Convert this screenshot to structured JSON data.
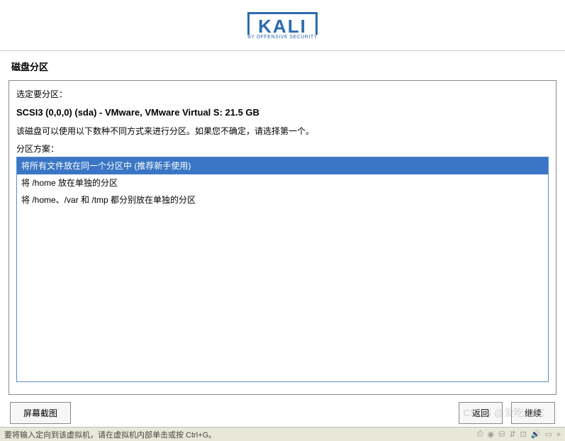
{
  "logo": {
    "text": "KALI",
    "tagline": "BY OFFENSIVE SECURITY"
  },
  "page_title": "磁盘分区",
  "content": {
    "prompt": "选定要分区：",
    "disk": "SCSI3 (0,0,0) (sda) - VMware, VMware Virtual S: 21.5 GB",
    "instruction": "该磁盘可以使用以下数种不同方式来进行分区。如果您不确定，请选择第一个。",
    "scheme_label": "分区方案：",
    "options": [
      "将所有文件放在同一个分区中 (推荐新手使用)",
      "将 /home 放在单独的分区",
      "将 /home、/var 和 /tmp 都分别放在单独的分区"
    ],
    "selected_index": 0
  },
  "buttons": {
    "screenshot": "屏幕截图",
    "back": "返回",
    "continue": "继续"
  },
  "status": {
    "message": "要将输入定向到该虚拟机，请在虚拟机内部单击或按 Ctrl+G。"
  },
  "watermark": "CSDN @爱吃仡柁"
}
